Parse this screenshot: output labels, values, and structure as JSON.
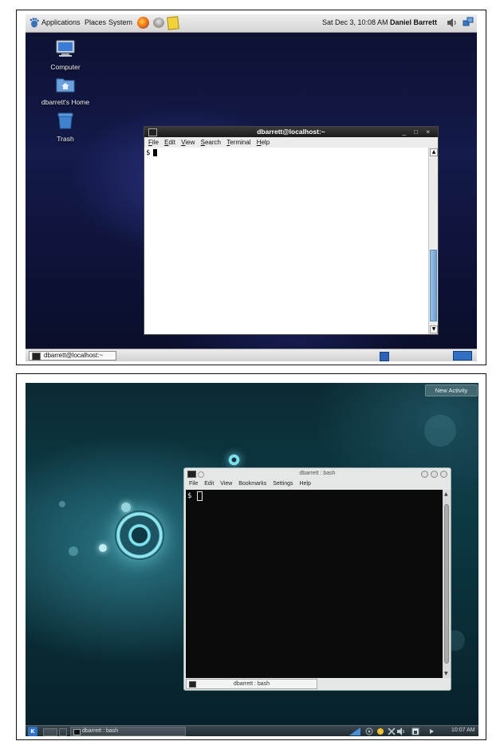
{
  "gnome": {
    "top_panel": {
      "menus": [
        "Applications",
        "Places",
        "System"
      ],
      "clock": "Sat Dec  3, 10:08 AM",
      "user": "Daniel Barrett"
    },
    "desktop_icons": [
      {
        "label": "Computer",
        "icon": "computer-icon"
      },
      {
        "label": "dbarrett's Home",
        "icon": "home-folder-icon"
      },
      {
        "label": "Trash",
        "icon": "trash-icon"
      }
    ],
    "terminal": {
      "title": "dbarrett@localhost:~",
      "controls": "_ □ ×",
      "menus": [
        "File",
        "Edit",
        "View",
        "Search",
        "Terminal",
        "Help"
      ],
      "prompt": "$"
    },
    "taskbar": {
      "task_label": "dbarrett@localhost:~"
    }
  },
  "kde": {
    "new_activity": "New Activity",
    "konsole": {
      "title": "dbarrett : bash",
      "menus": [
        "File",
        "Edit",
        "View",
        "Bookmarks",
        "Settings",
        "Help"
      ],
      "prompt": "$",
      "tab_label": "dbarrett : bash"
    },
    "panel": {
      "task_label": "dbarrett : bash",
      "clock": "10:07 AM"
    }
  },
  "colors": {
    "gnome_bg": "#141a4a",
    "kde_bg": "#0d3a45",
    "scroll_accent": "#6b9fd4"
  }
}
